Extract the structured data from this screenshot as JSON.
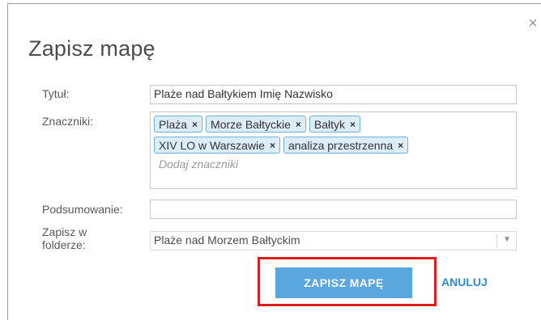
{
  "dialog": {
    "title": "Zapisz mapę",
    "close_glyph": "×"
  },
  "form": {
    "title_label": "Tytuł:",
    "title_value": "Plaże nad Bałtykiem Imię Nazwisko",
    "tags_label": "Znaczniki:",
    "tags": [
      "Plaża",
      "Morze Bałtyckie",
      "Bałtyk",
      "XIV LO w Warszawie",
      "analiza przestrzenna"
    ],
    "tag_remove_glyph": "×",
    "tags_placeholder": "Dodaj znaczniki",
    "summary_label": "Podsumowanie:",
    "summary_value": "",
    "folder_label_line1": "Zapisz w",
    "folder_label_line2": "folderze:",
    "folder_value": "Plaże nad Morzem Bałtyckim"
  },
  "buttons": {
    "save": "ZAPISZ MAPĘ",
    "cancel": "ANULUJ"
  },
  "colors": {
    "primary_button": "#5aa6de",
    "tag_border": "#6fb1d8",
    "tag_background": "#dcedf8",
    "link": "#2e8bcf",
    "highlight": "#e01b1b"
  },
  "icons": {
    "close": "close-icon",
    "tag_remove": "tag-remove-icon",
    "dropdown": "chevron-down-icon"
  }
}
